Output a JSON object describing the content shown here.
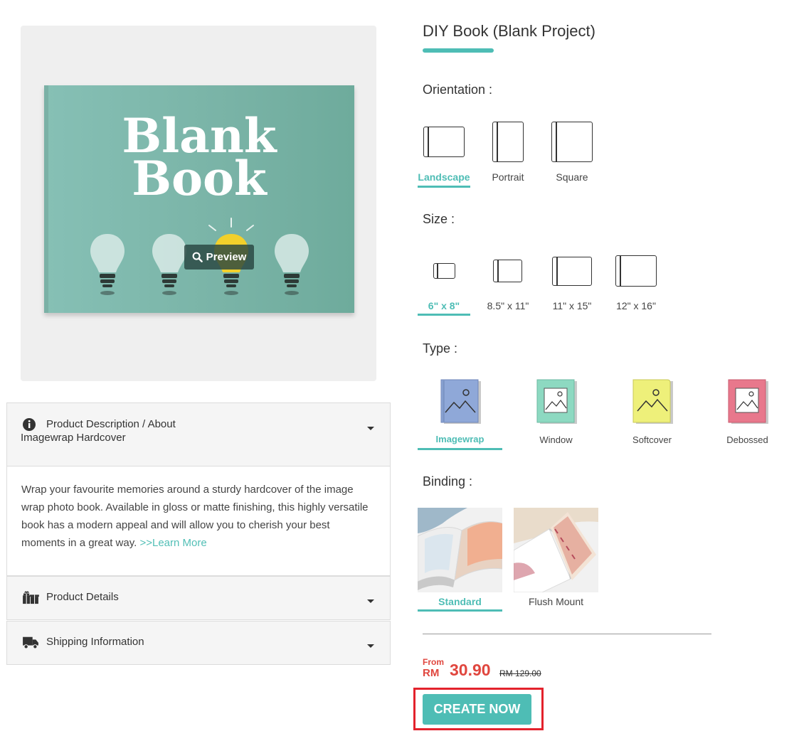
{
  "product": {
    "title": "DIY Book (Blank Project)",
    "cover_line1": "Blank",
    "cover_line2": "Book",
    "preview_label": "Preview"
  },
  "orientation": {
    "label": "Orientation :",
    "options": [
      {
        "label": "Landscape",
        "selected": true
      },
      {
        "label": "Portrait",
        "selected": false
      },
      {
        "label": "Square",
        "selected": false
      }
    ]
  },
  "size": {
    "label": "Size :",
    "options": [
      {
        "label": "6\" x 8\"",
        "selected": true
      },
      {
        "label": "8.5\" x 11\"",
        "selected": false
      },
      {
        "label": "11\" x 15\"",
        "selected": false
      },
      {
        "label": "12\" x 16\"",
        "selected": false
      }
    ]
  },
  "type": {
    "label": "Type :",
    "options": [
      {
        "label": "Imagewrap",
        "selected": true,
        "color": "#8fa8d8"
      },
      {
        "label": "Window",
        "selected": false,
        "color": "#8dd9c1"
      },
      {
        "label": "Softcover",
        "selected": false,
        "color": "#eef07a"
      },
      {
        "label": "Debossed",
        "selected": false,
        "color": "#e8788c"
      }
    ]
  },
  "binding": {
    "label": "Binding :",
    "options": [
      {
        "label": "Standard",
        "selected": true
      },
      {
        "label": "Flush Mount",
        "selected": false
      }
    ]
  },
  "accordion": {
    "description_title": "Product Description / About Imagewrap Hardcover",
    "description_title_line1": "Product Description / About",
    "description_title_line2": "Imagewrap Hardcover",
    "description_text": "Wrap your favourite memories around a sturdy hardcover of the image wrap photo book. Available in gloss or matte finishing, this highly versatile book has a modern appeal and will allow you to cherish your best moments in a great way.",
    "learn_more": ">>Learn More",
    "details_title": "Product Details",
    "shipping_title": "Shipping Information"
  },
  "price": {
    "from_label": "From",
    "currency": "RM",
    "value": "30.90",
    "old_price": "RM 129.00"
  },
  "cta": {
    "label": "CREATE NOW"
  },
  "colors": {
    "accent": "#4ebdb5",
    "price": "#e0463e",
    "highlight_outline": "#e3222c",
    "book_cover": "#7db6a9",
    "bulb_lit": "#f2d02b"
  }
}
